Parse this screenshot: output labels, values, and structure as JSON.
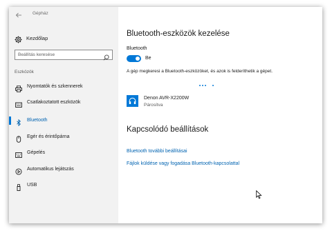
{
  "window": {
    "title": "Gépház"
  },
  "sidebar": {
    "home_label": "Kezdőlap",
    "search_placeholder": "Beállítás keresése",
    "section_label": "Eszközök",
    "items": [
      {
        "label": "Nyomtatók és szkennerek",
        "icon": "printer-icon"
      },
      {
        "label": "Csatlakoztatott eszközök",
        "icon": "keyboard-icon"
      },
      {
        "label": "Bluetooth",
        "icon": "bluetooth-icon",
        "active": true
      },
      {
        "label": "Egér és érintőpárna",
        "icon": "mouse-icon"
      },
      {
        "label": "Gépelés",
        "icon": "typing-icon"
      },
      {
        "label": "Automatikus lejátszás",
        "icon": "autoplay-icon"
      },
      {
        "label": "USB",
        "icon": "usb-icon"
      }
    ]
  },
  "main": {
    "title": "Bluetooth-eszközök kezelése",
    "bluetooth_label": "Bluetooth",
    "toggle_state": "Be",
    "toggle_on": true,
    "description": "A gép megkeresi a Bluetooth-eszközöket, és azok is felderíthetik a gépet.",
    "device": {
      "name": "Denon AVR-X2200W",
      "status": "Párosítva",
      "icon": "headphones-icon"
    },
    "related_title": "Kapcsolódó beállítások",
    "links": [
      "Bluetooth további beállításai",
      "Fájlok küldése vagy fogadása Bluetooth-kapcsolattal"
    ]
  },
  "colors": {
    "accent": "#0078d7",
    "link": "#0063b1",
    "sidebar_bg": "#f2f2f2"
  }
}
